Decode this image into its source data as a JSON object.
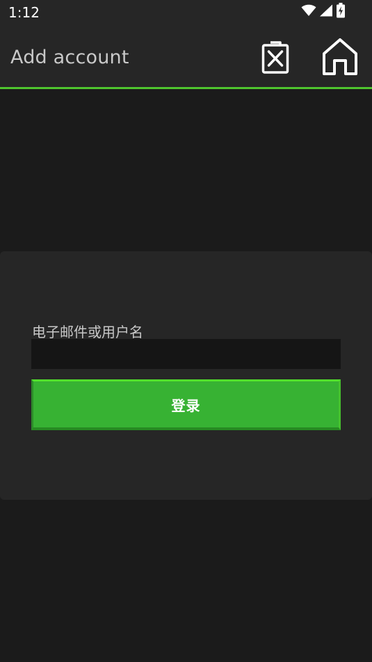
{
  "status_bar": {
    "time": "1:12",
    "icons": [
      "wifi-icon",
      "cellular-signal-icon",
      "battery-charging-icon"
    ]
  },
  "app_bar": {
    "title": "Add account",
    "actions": [
      {
        "name": "clear-button",
        "icon": "clear-document-icon"
      },
      {
        "name": "home-button",
        "icon": "home-icon"
      }
    ],
    "accent_color": "#4fc52e"
  },
  "login_form": {
    "field_label": "电子邮件或用户名",
    "field_value": "",
    "login_label": "登录",
    "button_color": "#37b233"
  }
}
